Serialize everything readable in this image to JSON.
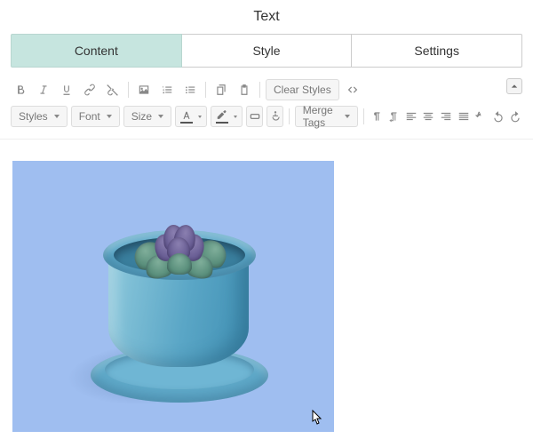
{
  "panel": {
    "title": "Text"
  },
  "tabs": [
    {
      "label": "Content",
      "active": true
    },
    {
      "label": "Style",
      "active": false
    },
    {
      "label": "Settings",
      "active": false
    }
  ],
  "toolbar": {
    "clear_styles": "Clear Styles",
    "styles": "Styles",
    "font": "Font",
    "size": "Size",
    "merge_tags": "Merge Tags"
  },
  "content": {
    "image": {
      "description": "succulent-in-blue-pot",
      "overlay_tint": "#9fbef0"
    }
  }
}
